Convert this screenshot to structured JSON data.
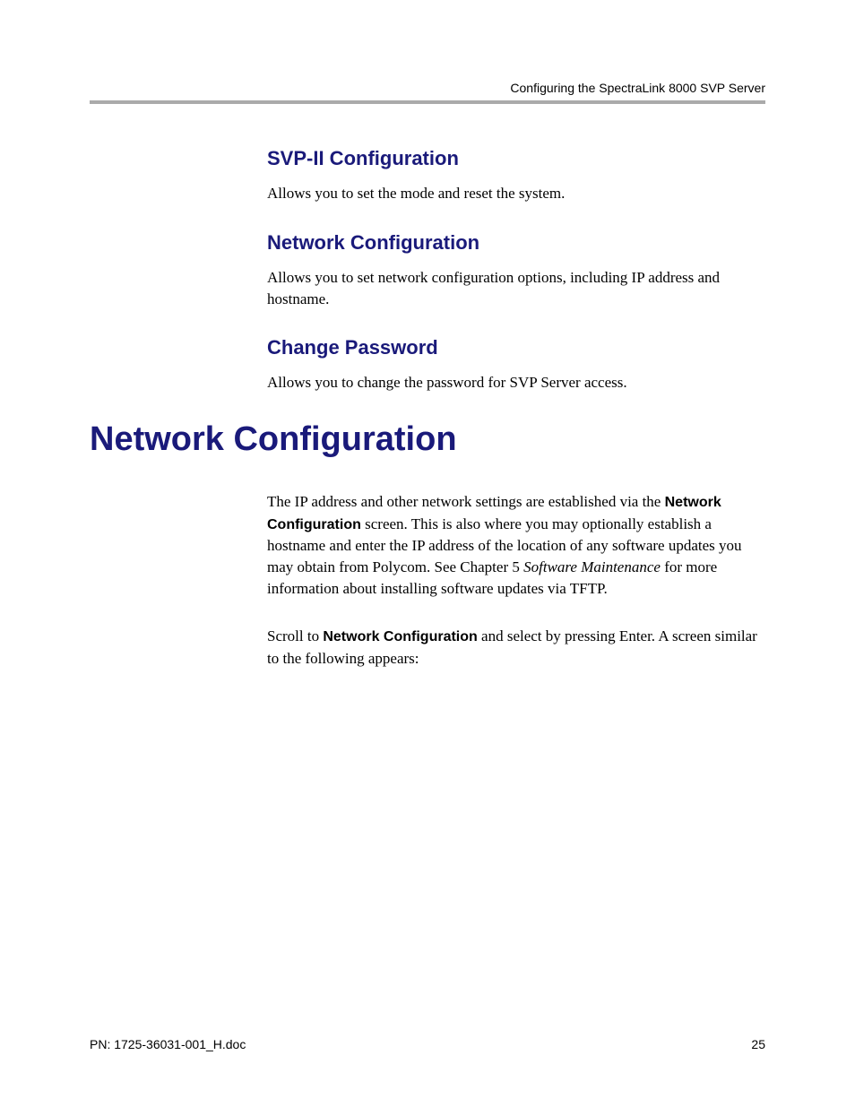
{
  "header": {
    "title": "Configuring the SpectraLink 8000 SVP Server"
  },
  "sections": {
    "svp": {
      "heading": "SVP-II Configuration",
      "body": "Allows you to set the mode and reset the system."
    },
    "network_sub": {
      "heading": "Network Configuration",
      "body": "Allows you to set network configuration options, including IP address and hostname."
    },
    "password": {
      "heading": "Change Password",
      "body": "Allows you to change the password for SVP Server access."
    }
  },
  "main": {
    "heading": "Network Configuration",
    "para1": {
      "part1": "The IP address and other network settings are established via the ",
      "bold1": "Network Configuration",
      "part2": " screen. This is also where you may optionally establish a hostname and enter the IP address of the location of any software updates you may obtain from Polycom. See Chapter 5 ",
      "italic1": "Software Maintenance",
      "part3": " for more information about installing software updates via TFTP."
    },
    "para2": {
      "part1": "Scroll to ",
      "bold1": "Network Configuration",
      "part2": " and select by pressing Enter. A screen similar to the following appears:"
    }
  },
  "footer": {
    "left": "PN: 1725-36031-001_H.doc",
    "right": "25"
  }
}
